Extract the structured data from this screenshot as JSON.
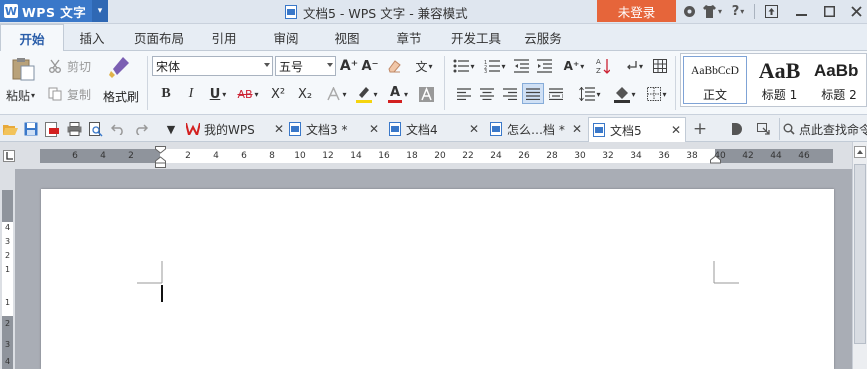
{
  "titlebar": {
    "app_name": "WPS 文字",
    "app_logo": "W",
    "document_title": "文档5 - WPS 文字 - 兼容模式",
    "login_label": "未登录",
    "help_label": "?"
  },
  "menu": {
    "tabs": [
      "开始",
      "插入",
      "页面布局",
      "引用",
      "审阅",
      "视图",
      "章节",
      "开发工具",
      "云服务"
    ]
  },
  "ribbon": {
    "paste_label": "粘贴",
    "cut_label": "剪切",
    "copy_label": "复制",
    "format_painter_label": "格式刷",
    "font_name": "宋体",
    "font_size": "五号",
    "bold": "B",
    "italic": "I",
    "underline": "U",
    "strikethrough": "AB",
    "superscript": "X²",
    "subscript": "X₂",
    "font_color_letter": "A",
    "highlight_color": "#f5d40f",
    "font_color": "#d32020",
    "grow_font": "A⁺",
    "shrink_font": "A⁻",
    "phonetic": "文",
    "styles": [
      {
        "preview": "AaBbCcD",
        "label": "正文"
      },
      {
        "preview": "AaB",
        "label": "标题 1"
      },
      {
        "preview": "AaBb",
        "label": "标题 2"
      }
    ]
  },
  "doc_tabs": [
    {
      "label": "我的WPS"
    },
    {
      "label": "文档3 *"
    },
    {
      "label": "文档4"
    },
    {
      "label": "怎么…档 *"
    },
    {
      "label": "文档5"
    }
  ],
  "search": {
    "label": "点此查找命令"
  },
  "ruler": {
    "left_numbers": [
      "6",
      "4",
      "2"
    ],
    "numbers": [
      "2",
      "4",
      "6",
      "8",
      "10",
      "12",
      "14",
      "16",
      "18",
      "20",
      "22",
      "24",
      "26",
      "28",
      "30",
      "32",
      "34",
      "36",
      "38"
    ],
    "right_numbers": [
      "40",
      "42",
      "44",
      "46"
    ],
    "vertical_numbers": [
      "4",
      "3",
      "2",
      "1",
      "1",
      "2",
      "3",
      "4"
    ]
  },
  "colors": {
    "accent": "#3a78c9",
    "login": "#e6653a"
  }
}
